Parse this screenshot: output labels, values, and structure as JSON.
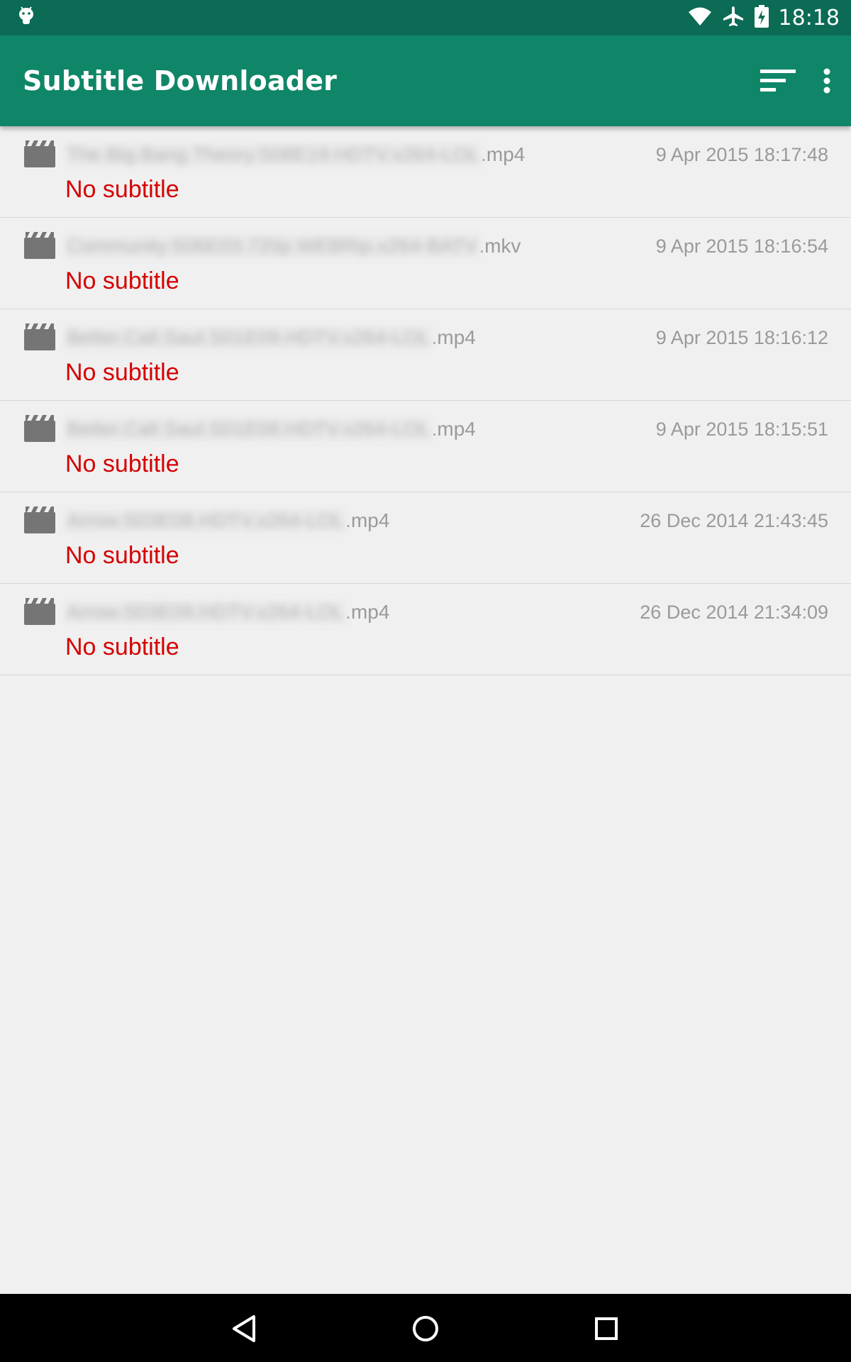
{
  "status_bar": {
    "time": "18:18",
    "icons": [
      "android-icon",
      "wifi-icon",
      "airplane-icon",
      "battery-charging-icon"
    ]
  },
  "app_bar": {
    "title": "Subtitle Downloader",
    "actions": [
      "sort-icon",
      "overflow-menu-icon"
    ],
    "background": "#108668",
    "status_background": "#0b6b55"
  },
  "files": [
    {
      "name": "The.Big.Bang.Theory.S08E19.HDTV.x264-LOL",
      "ext": ".mp4",
      "date": "9 Apr 2015 18:17:48",
      "status": "No subtitle"
    },
    {
      "name": "Community.S06E03.720p.WEBRip.x264-BATV",
      "ext": ".mkv",
      "date": "9 Apr 2015 18:16:54",
      "status": "No subtitle"
    },
    {
      "name": "Better.Call.Saul.S01E09.HDTV.x264-LOL",
      "ext": ".mp4",
      "date": "9 Apr 2015 18:16:12",
      "status": "No subtitle"
    },
    {
      "name": "Better.Call.Saul.S01E08.HDTV.x264-LOL",
      "ext": ".mp4",
      "date": "9 Apr 2015 18:15:51",
      "status": "No subtitle"
    },
    {
      "name": "Arrow.S03E08.HDTV.x264-LOL",
      "ext": ".mp4",
      "date": "26 Dec 2014 21:43:45",
      "status": "No subtitle"
    },
    {
      "name": "Arrow.S03E09.HDTV.x264-LOL",
      "ext": ".mp4",
      "date": "26 Dec 2014 21:34:09",
      "status": "No subtitle"
    }
  ],
  "colors": {
    "status_error": "#d50000",
    "secondary_text": "#9a9a9a",
    "background": "#f0f0f0"
  },
  "nav_bar": {
    "buttons": [
      "back-icon",
      "home-icon",
      "recents-icon"
    ]
  }
}
